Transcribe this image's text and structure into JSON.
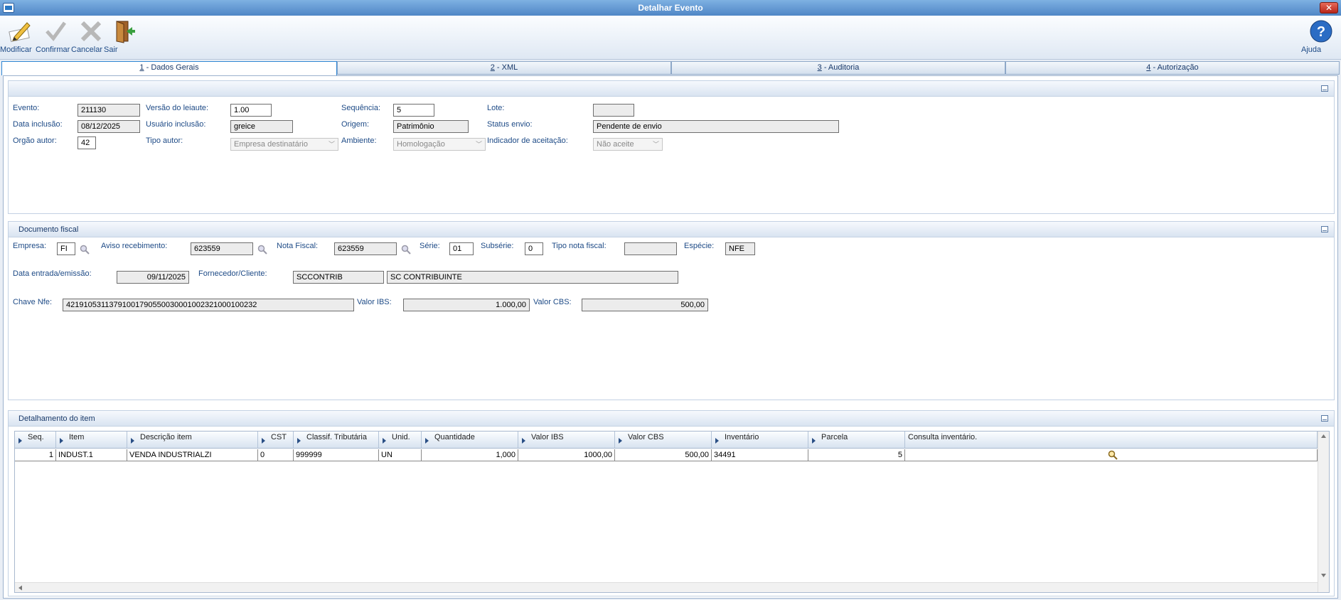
{
  "window": {
    "title": "Detalhar Evento",
    "close_label": "✕"
  },
  "toolbar": {
    "modificar": "Modificar",
    "confirmar": "Confirmar",
    "cancelar": "Cancelar",
    "sair": "Sair",
    "ajuda": "Ajuda"
  },
  "tabs": [
    {
      "num": "1",
      "label": " - Dados Gerais"
    },
    {
      "num": "2",
      "label": " - XML"
    },
    {
      "num": "3",
      "label": " - Auditoria"
    },
    {
      "num": "4",
      "label": " - Autorização"
    }
  ],
  "dados_gerais": {
    "evento_label": "Evento:",
    "evento": "211130",
    "versao_label": "Versão do leiaute:",
    "versao": "1.00",
    "sequencia_label": "Sequência:",
    "sequencia": "5",
    "lote_label": "Lote:",
    "lote": "",
    "data_inclusao_label": "Data inclusão:",
    "data_inclusao": "08/12/2025",
    "usuario_label": "Usuário inclusão:",
    "usuario": "greice",
    "origem_label": "Origem:",
    "origem": "Patrimônio",
    "status_label": "Status envio:",
    "status": "Pendente de envio",
    "orgao_label": "Orgão autor:",
    "orgao": "42",
    "tipo_autor_label": "Tipo autor:",
    "tipo_autor": "Empresa destinatário",
    "ambiente_label": "Ambiente:",
    "ambiente": "Homologação",
    "indicador_label": "Indicador de aceitação:",
    "indicador": "Não aceite"
  },
  "documento": {
    "title": "Documento fiscal",
    "empresa_label": "Empresa:",
    "empresa": "FI",
    "aviso_label": "Aviso recebimento:",
    "aviso": "623559",
    "nota_label": "Nota Fiscal:",
    "nota": "623559",
    "serie_label": "Série:",
    "serie": "01",
    "subserie_label": "Subsérie:",
    "subserie": "0",
    "tipo_nota_label": "Tipo nota fiscal:",
    "tipo_nota": "",
    "especie_label": "Espécie:",
    "especie": "NFE",
    "data_label": "Data entrada/emissão:",
    "data": "09/11/2025",
    "fornecedor_label": "Fornecedor/Cliente:",
    "fornecedor_cod": "SCCONTRIB",
    "fornecedor_nome": "SC CONTRIBUINTE",
    "chave_label": "Chave Nfe:",
    "chave": "42191053113791001790550030001002321000100232",
    "ibs_label": "Valor IBS:",
    "ibs": "1.000,00",
    "cbs_label": "Valor CBS:",
    "cbs": "500,00"
  },
  "detalhamento": {
    "title": "Detalhamento do item",
    "columns": [
      "Seq.",
      "Item",
      "Descrição item",
      "CST",
      "Classif. Tributária",
      "Unid.",
      "Quantidade",
      "Valor IBS",
      "Valor CBS",
      "Inventário",
      "Parcela",
      "Consulta inventário."
    ],
    "rows": [
      [
        "1",
        "INDUST.1",
        "VENDA INDUSTRIALZI",
        "0",
        "999999",
        "UN",
        "1,000",
        "1000,00",
        "500,00",
        "34491",
        "5",
        ""
      ]
    ]
  }
}
